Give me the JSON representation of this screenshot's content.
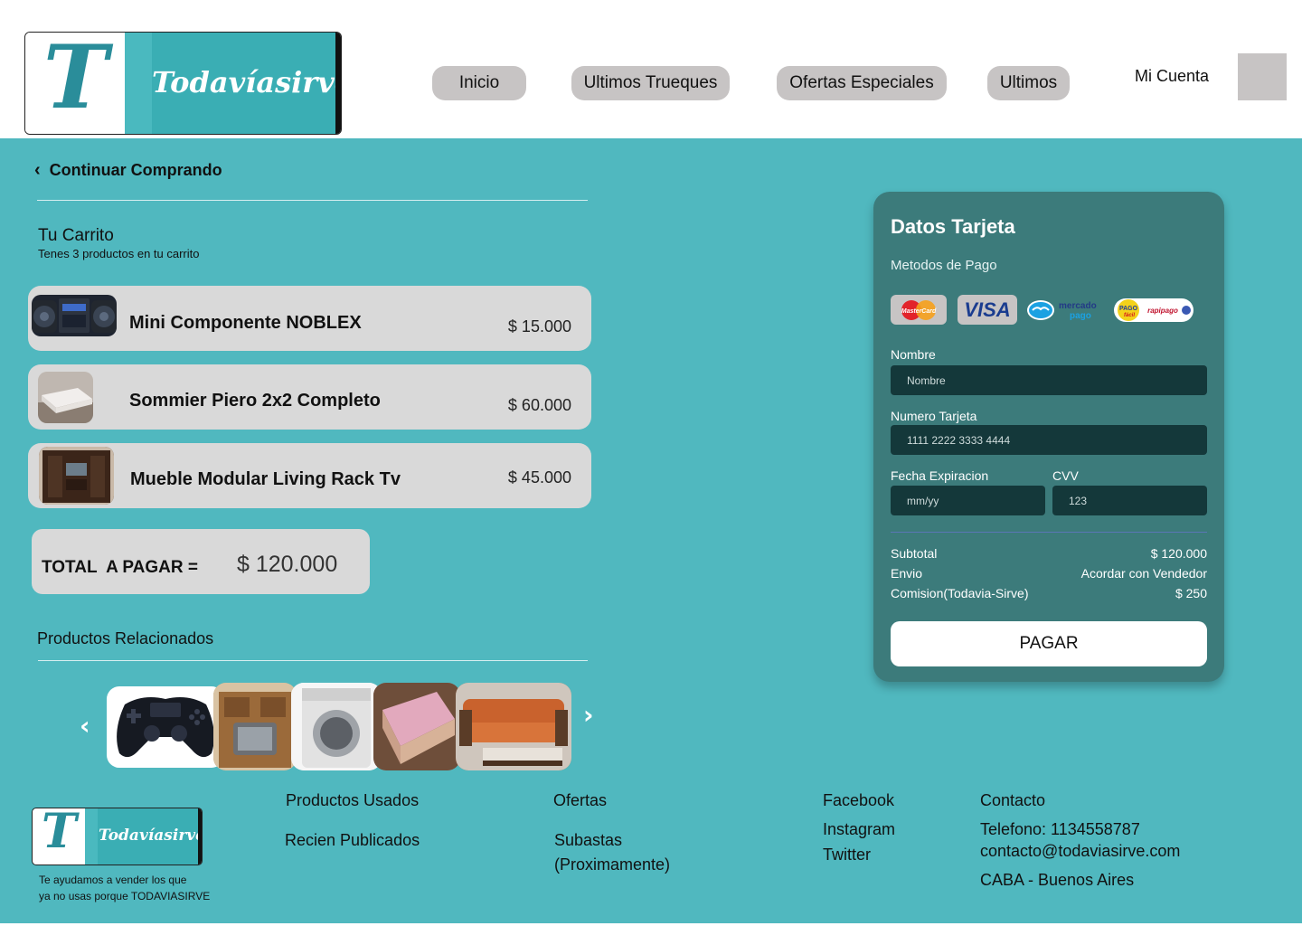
{
  "header": {
    "brand": {
      "letter": "T",
      "name": "Todavíasirve"
    },
    "nav": [
      {
        "label": "Inicio"
      },
      {
        "label": "Ultimos Trueques"
      },
      {
        "label": "Ofertas Especiales"
      },
      {
        "label": "Ultimos"
      }
    ],
    "account_label": "Mi Cuenta"
  },
  "cart": {
    "back_label": "Continuar Comprando",
    "title": "Tu Carrito",
    "subtitle": "Tenes 3 productos en tu carrito",
    "items": [
      {
        "name": "Mini Componente NOBLEX",
        "price": "$ 15.000",
        "icon": "stereo-image"
      },
      {
        "name": "Sommier Piero 2x2 Completo",
        "price": "$ 60.000",
        "icon": "bed-image"
      },
      {
        "name": "Mueble Modular Living Rack Tv",
        "price": "$ 45.000",
        "icon": "furniture-image"
      }
    ],
    "total_label": "TOTAL  A PAGAR =",
    "total_value": "$ 120.000"
  },
  "related": {
    "title": "Productos Relacionados",
    "items": [
      {
        "icon": "gamepad-image"
      },
      {
        "icon": "tv-cabinet-image"
      },
      {
        "icon": "washing-machine-image"
      },
      {
        "icon": "kids-bed-image"
      },
      {
        "icon": "sofa-bed-image"
      }
    ]
  },
  "payment": {
    "title": "Datos Tarjeta",
    "methods_label": "Metodos de Pago",
    "methods": [
      {
        "label": "MasterCard"
      },
      {
        "label": "VISA"
      },
      {
        "label": "mercado pago"
      },
      {
        "label": "PAGO fácil rapipago"
      }
    ],
    "name_label": "Nombre",
    "name_placeholder": "Nombre",
    "card_label": "Numero Tarjeta",
    "card_placeholder": "1111 2222 3333 4444",
    "exp_label": "Fecha Expiracion",
    "exp_placeholder": "mm/yy",
    "cvv_label": "CVV",
    "cvv_placeholder": "123",
    "summary": [
      {
        "label": "Subtotal",
        "value": "$ 120.000"
      },
      {
        "label": "Envio",
        "value": "Acordar con Vendedor"
      },
      {
        "label": "Comision(Todavia-Sirve)",
        "value": "$ 250"
      }
    ],
    "pay_button": "PAGAR"
  },
  "footer": {
    "brand": {
      "letter": "T",
      "name": "Todavíasirve"
    },
    "tagline_1": "Te ayudamos a vender los que",
    "tagline_2": "ya no usas porque TODAVIASIRVE",
    "col1": [
      "Productos Usados",
      "Recien Publicados"
    ],
    "col2": [
      "Ofertas",
      "Subastas",
      "(Proximamente)"
    ],
    "col3": [
      "Facebook",
      "Instagram",
      "Twitter"
    ],
    "col4": [
      "Contacto",
      "Telefono: 1134558787",
      "contacto@todaviasirve.com",
      "CABA - Buenos Aires"
    ]
  },
  "colors": {
    "teal_bg": "#50b8bf",
    "card_panel": "#3c7b7b",
    "input_bg": "#14383a",
    "chip_gray": "#d9d9d9"
  }
}
